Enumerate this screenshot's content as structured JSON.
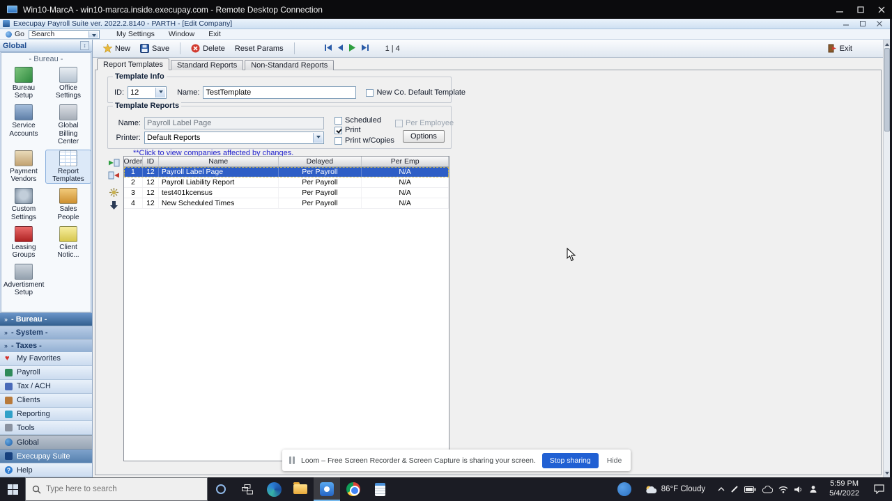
{
  "icons": {
    "heart": "♥",
    "help": "?",
    "panel_toggle": "↕",
    "group_chevron": "»"
  },
  "rdp": {
    "title": "Win10-MarcA - win10-marca.inside.execupay.com - Remote Desktop Connection"
  },
  "app": {
    "title": "Execupay Payroll Suite ver. 2022.2.8140 - PARTH - [Edit Company]"
  },
  "menubar": {
    "go": "Go",
    "search": "Search",
    "my_settings": "My Settings",
    "window": "Window",
    "exit": "Exit"
  },
  "toolbar": {
    "new": "New",
    "save": "Save",
    "delete": "Delete",
    "reset_params": "Reset Params",
    "record_position": "1 | 4",
    "exit": "Exit"
  },
  "tabs": {
    "report_templates": "Report Templates",
    "standard_reports": "Standard Reports",
    "non_standard_reports": "Non-Standard Reports"
  },
  "template_info": {
    "title": "Template Info",
    "id_label": "ID:",
    "id_value": "12",
    "name_label": "Name:",
    "name_value": "TestTemplate",
    "new_co_default_label": "New Co. Default Template"
  },
  "template_reports": {
    "title": "Template Reports",
    "name_label": "Name:",
    "name_value": "Payroll Label Page",
    "printer_label": "Printer:",
    "printer_value": "Default Reports",
    "scheduled_label": "Scheduled",
    "print_label": "Print",
    "print_w_copies_label": "Print w/Copies",
    "per_employee_label": "Per Employee",
    "options_label": "Options",
    "link": "**Click to view companies affected by changes."
  },
  "grid": {
    "columns": [
      "Order",
      "ID",
      "Name",
      "Delayed",
      "Per Emp"
    ],
    "rows": [
      [
        "1",
        "12",
        "Payroll Label Page",
        "Per Payroll",
        "N/A"
      ],
      [
        "2",
        "12",
        "Payroll Liability Report",
        "Per Payroll",
        "N/A"
      ],
      [
        "3",
        "12",
        "test401kcensus",
        "Per Payroll",
        "N/A"
      ],
      [
        "4",
        "12",
        "New Scheduled Times",
        "Per Payroll",
        "N/A"
      ]
    ]
  },
  "sidebar": {
    "header": "Global",
    "section": "- Bureau -",
    "icons": [
      "Bureau Setup",
      "Office Settings",
      "Service Accounts",
      "Global Billing Center",
      "Payment Vendors",
      "Report Templates",
      "Custom Settings",
      "Sales People",
      "Leasing Groups",
      "Client Notic...",
      "Advertisment Setup"
    ],
    "groups": [
      "- Bureau -",
      "- System -",
      "- Taxes -"
    ],
    "nav": [
      "My Favorites",
      "Payroll",
      "Tax / ACH",
      "Clients",
      "Reporting",
      "Tools",
      "Global",
      "Execupay Suite",
      "Help"
    ]
  },
  "loom": {
    "message": "Loom – Free Screen Recorder & Screen Capture is sharing your screen.",
    "stop": "Stop sharing",
    "hide": "Hide"
  },
  "taskbar": {
    "search_placeholder": "Type here to search",
    "weather": "86°F Cloudy",
    "time": "5:59 PM",
    "date": "5/4/2022"
  },
  "colors": {
    "selection": "#2E5EC6",
    "stop_button": "#2160D3",
    "link": "#2222CC"
  }
}
